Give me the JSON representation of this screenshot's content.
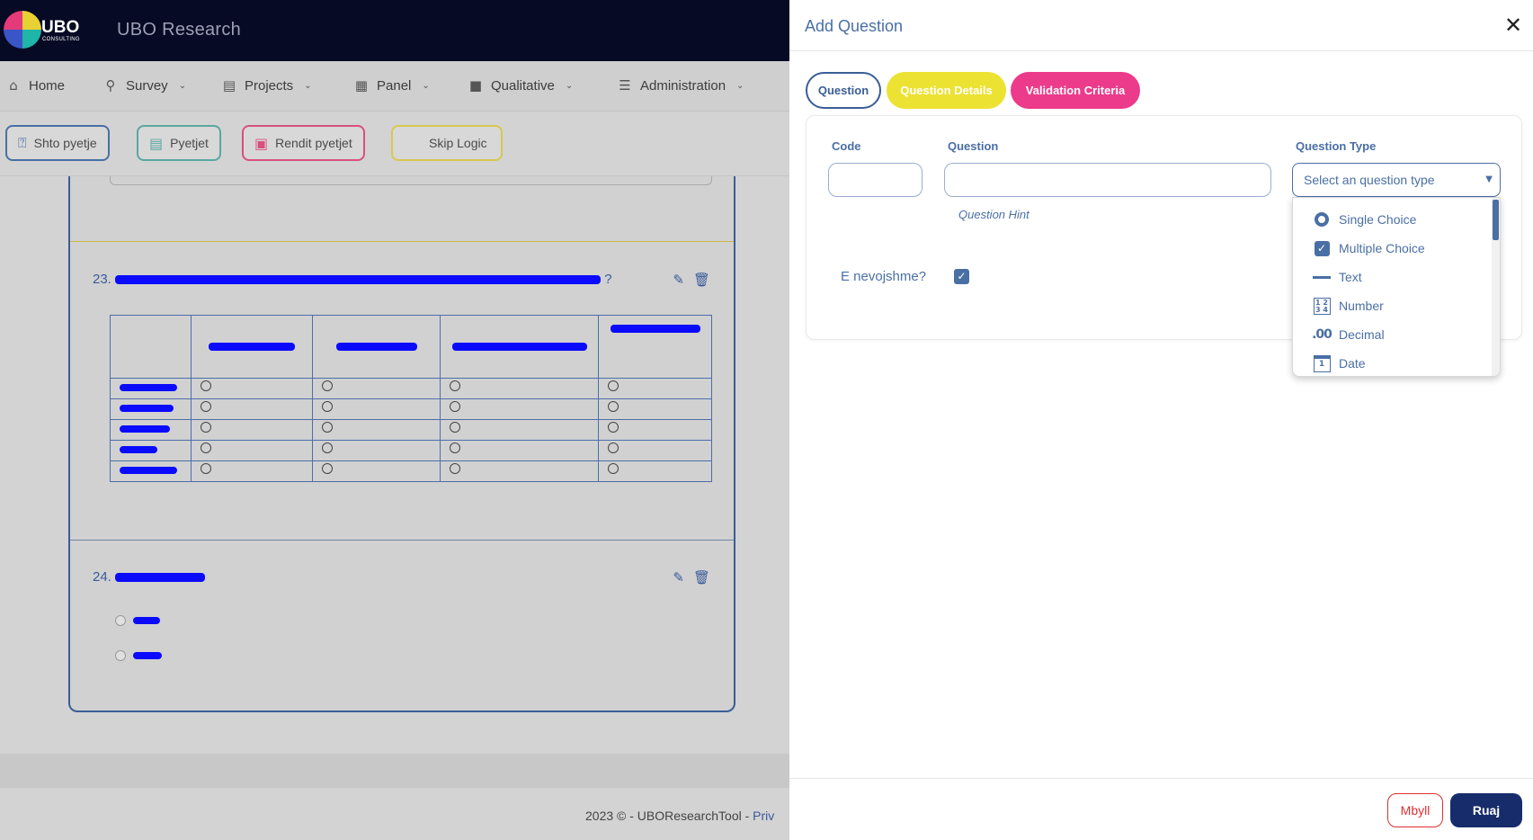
{
  "app": {
    "logo_text": "UBO",
    "logo_sub": "CONSULTING",
    "brand": "UBO Research"
  },
  "nav": {
    "items": [
      {
        "label": "Home",
        "icon": "home-icon"
      },
      {
        "label": "Survey",
        "icon": "search-icon"
      },
      {
        "label": "Projects",
        "icon": "briefcase-icon"
      },
      {
        "label": "Panel",
        "icon": "grid-icon"
      },
      {
        "label": "Qualitative",
        "icon": "video-icon"
      },
      {
        "label": "Administration",
        "icon": "sliders-icon"
      }
    ]
  },
  "toolbar": {
    "add_question": "Shto pyetje",
    "questions": "Pyetjet",
    "order_questions": "Rendit pyetjet",
    "skip_logic": "Skip Logic"
  },
  "survey": {
    "q23": {
      "number": "23.",
      "suffix": "?"
    },
    "q24": {
      "number": "24."
    }
  },
  "footer": {
    "text": "2023 © - UBOResearchTool - ",
    "link": "Priv"
  },
  "panel": {
    "title": "Add Question",
    "tabs": {
      "question": "Question",
      "details": "Question Details",
      "validation": "Validation Criteria"
    },
    "form": {
      "code_label": "Code",
      "code_value": "",
      "question_label": "Question",
      "question_value": "",
      "question_hint": "Question Hint",
      "type_label": "Question Type",
      "type_placeholder": "Select an question type",
      "required_label": "E nevojshme?",
      "required_checked": true
    },
    "dropdown": {
      "options": [
        {
          "label": "Single Choice",
          "icon": "radio-icon"
        },
        {
          "label": "Multiple Choice",
          "icon": "checkbox-icon"
        },
        {
          "label": "Text",
          "icon": "text-icon"
        },
        {
          "label": "Number",
          "icon": "number-icon",
          "glyph": "1 2\n3 4"
        },
        {
          "label": "Decimal",
          "icon": "decimal-icon",
          "glyph": ".00"
        },
        {
          "label": "Date",
          "icon": "calendar-icon",
          "glyph": "1"
        }
      ]
    },
    "buttons": {
      "close": "Mbyll",
      "save": "Ruaj"
    }
  },
  "colors": {
    "accent": "#4a6fa5",
    "navy": "#172c6b",
    "yellow": "#ece232",
    "pink": "#ec3b8a",
    "danger": "#e03030"
  }
}
